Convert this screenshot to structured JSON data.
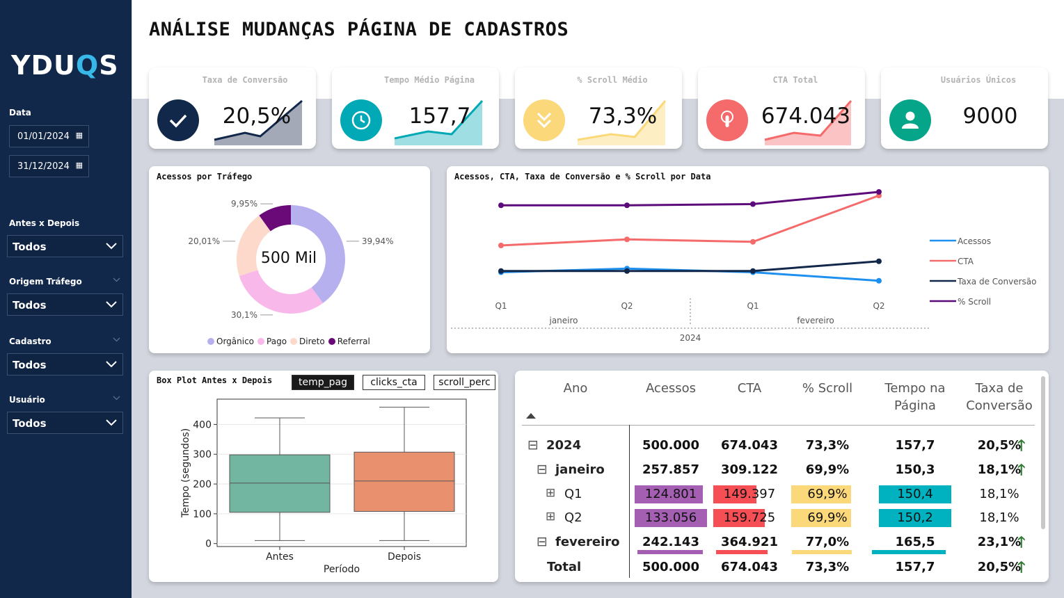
{
  "header": {
    "title": "ANÁLISE MUDANÇAS PÁGINA DE CADASTROS"
  },
  "sidebar": {
    "logo_text_a": "YDU",
    "logo_text_q": "Q",
    "logo_text_b": "S",
    "date_label": "Data",
    "date_from": "01/01/2024",
    "date_to": "31/12/2024",
    "filters": [
      {
        "label": "Antes x Depois",
        "value": "Todos"
      },
      {
        "label": "Origem Tráfego",
        "value": "Todos"
      },
      {
        "label": "Cadastro",
        "value": "Todos"
      },
      {
        "label": "Usuário",
        "value": "Todos"
      }
    ]
  },
  "kpis": [
    {
      "label": "Taxa de Conversão",
      "value": "20,5%",
      "icon": "check-icon",
      "color": "#12284b"
    },
    {
      "label": "Tempo Médio Página",
      "value": "157,7",
      "icon": "clock-icon",
      "color": "#00a9b5"
    },
    {
      "label": "% Scroll Médio",
      "value": "73,3%",
      "icon": "double-chevron-down-icon",
      "color": "#fbd87a"
    },
    {
      "label": "CTA Total",
      "value": "674.043",
      "icon": "touch-icon",
      "color": "#f56a6a"
    },
    {
      "label": "Usuários Únicos",
      "value": "9000",
      "icon": "user-icon",
      "color": "#05a58a"
    }
  ],
  "donut": {
    "title": "Acessos por Tráfego",
    "center": "500 Mil",
    "chart_data": {
      "type": "pie",
      "categories": [
        "Orgânico",
        "Pago",
        "Direto",
        "Referral"
      ],
      "values": [
        39.94,
        30.1,
        20.01,
        9.95
      ],
      "labels": [
        "39,94%",
        "30,1%",
        "20,01%",
        "9,95%"
      ],
      "colors": [
        "#b7b0ef",
        "#f8b9ea",
        "#fcd9cb",
        "#6a0a78"
      ],
      "legend": "bottom"
    }
  },
  "linechart": {
    "title": "Acessos, CTA, Taxa de Conversão e % Scroll por Data",
    "quarters": [
      "Q1",
      "Q2",
      "Q1",
      "Q2"
    ],
    "months": [
      "janeiro",
      "fevereiro"
    ],
    "year": "2024",
    "chart_data": {
      "type": "line",
      "x": [
        "janeiro Q1",
        "janeiro Q2",
        "fevereiro Q1",
        "fevereiro Q2"
      ],
      "series": [
        {
          "name": "Acessos",
          "color": "#1e90f0",
          "values": [
            0.3,
            0.33,
            0.3,
            0.23
          ]
        },
        {
          "name": "CTA",
          "color": "#f56a6a",
          "values": [
            0.52,
            0.57,
            0.55,
            0.93
          ]
        },
        {
          "name": "Taxa de Conversão",
          "color": "#12284b",
          "values": [
            0.31,
            0.31,
            0.31,
            0.39
          ]
        },
        {
          "name": "% Scroll",
          "color": "#5c0a7a",
          "values": [
            0.85,
            0.85,
            0.86,
            0.96
          ]
        }
      ],
      "ylim": [
        0,
        1
      ],
      "legend": "right"
    }
  },
  "boxplot": {
    "title": "Box Plot Antes x Depois",
    "tabs": [
      "temp_pag",
      "clicks_cta",
      "scroll_perc"
    ],
    "chart_data": {
      "type": "box",
      "categories": [
        "Antes",
        "Depois"
      ],
      "xlabel": "Período",
      "ylabel": "Tempo (segundos)",
      "yticks": [
        "0",
        "100",
        "200",
        "300",
        "400"
      ],
      "ylim": [
        -10,
        485
      ],
      "boxes": [
        {
          "name": "Antes",
          "min": 10,
          "q1": 105,
          "median": 203,
          "q3": 298,
          "max": 422,
          "color": "#72b5a0"
        },
        {
          "name": "Depois",
          "min": 10,
          "q1": 108,
          "median": 210,
          "q3": 307,
          "max": 458,
          "color": "#e9916e"
        }
      ]
    }
  },
  "matrix": {
    "headers": [
      "Ano",
      "Acessos",
      "CTA",
      "% Scroll",
      "Tempo na Página",
      "Taxa de Conversão"
    ],
    "header_lines": [
      [
        "Ano"
      ],
      [
        "Acessos"
      ],
      [
        "CTA"
      ],
      [
        "% Scroll"
      ],
      [
        "Tempo na",
        "Página"
      ],
      [
        "Taxa de",
        "Conversão"
      ]
    ],
    "rows": [
      {
        "label": "2024",
        "expander": "⊟",
        "values": [
          "500.000",
          "674.043",
          "73,3%",
          "157,7",
          "20,5%"
        ],
        "bold": true,
        "arrow": true
      },
      {
        "label": "janeiro",
        "expander": "⊟",
        "values": [
          "257.857",
          "309.122",
          "69,9%",
          "150,3",
          "18,1%"
        ],
        "bold": true,
        "arrow": true
      },
      {
        "label": "Q1",
        "expander": "⊞",
        "values": [
          "124.801",
          "149.397",
          "69,9%",
          "150,4",
          "18,1%"
        ],
        "bold": false,
        "arrow": false
      },
      {
        "label": "Q2",
        "expander": "⊞",
        "values": [
          "133.056",
          "159.725",
          "69,9%",
          "150,2",
          "18,1%"
        ],
        "bold": false,
        "arrow": false
      },
      {
        "label": "fevereiro",
        "expander": "⊟",
        "values": [
          "242.143",
          "364.921",
          "77,0%",
          "165,5",
          "23,1%"
        ],
        "bold": true,
        "arrow": true
      }
    ],
    "total": {
      "label": "Total",
      "values": [
        "500.000",
        "674.043",
        "73,3%",
        "157,7",
        "20,5%"
      ]
    },
    "bar_colors": [
      "#a45fb2",
      "#f54e54",
      "#fbd87a",
      "#00b1bf"
    ]
  }
}
